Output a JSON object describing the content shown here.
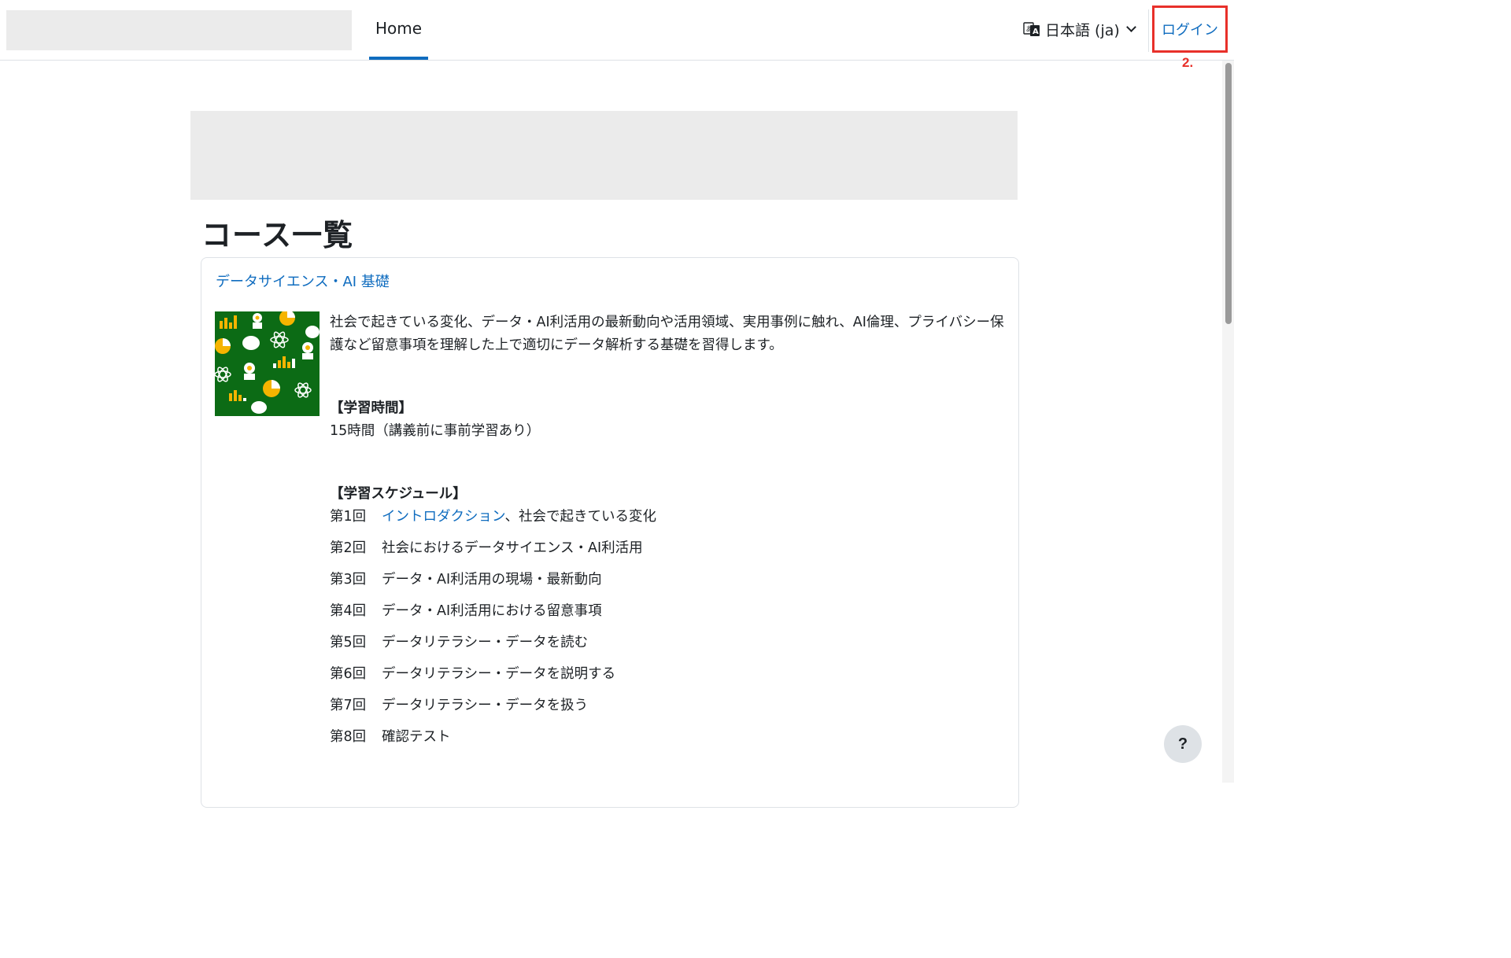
{
  "navbar": {
    "home_label": "Home",
    "language_label": "日本語 (ja)",
    "language_icon": "translate-icon",
    "login_label": "ログイン"
  },
  "annotation": {
    "step_label": "2."
  },
  "page": {
    "title": "コース一覧"
  },
  "course": {
    "name": "データサイエンス・AI 基礎",
    "description": "社会で起きている変化、データ・AI利活用の最新動向や活用領域、実用事例に触れ、AI倫理、プライバシー保護など留意事項を理解した上で適切にデータ解析する基礎を習得します。",
    "study_time_heading": "【学習時間】",
    "study_time_text": "15時間（講義前に事前学習あり）",
    "schedule_heading": "【学習スケジュール】",
    "schedule": [
      {
        "num": "第1回",
        "link": "イントロダクション",
        "text": "、社会で起きている変化"
      },
      {
        "num": "第2回",
        "link": "",
        "text": "社会におけるデータサイエンス・AI利活用"
      },
      {
        "num": "第3回",
        "link": "",
        "text": "データ・AI利活用の現場・最新動向"
      },
      {
        "num": "第4回",
        "link": "",
        "text": "データ・AI利活用における留意事項"
      },
      {
        "num": "第5回",
        "link": "",
        "text": "データリテラシー・データを読む"
      },
      {
        "num": "第6回",
        "link": "",
        "text": "データリテラシー・データを説明する"
      },
      {
        "num": "第7回",
        "link": "",
        "text": "データリテラシー・データを扱う"
      },
      {
        "num": "第8回",
        "link": "",
        "text": "確認テスト"
      }
    ]
  },
  "help": {
    "label": "?"
  },
  "colors": {
    "link": "#0f6cbf",
    "annotation": "#e8302a",
    "course_image_bg": "#0c6b15",
    "course_image_accent": "#f5b400"
  }
}
